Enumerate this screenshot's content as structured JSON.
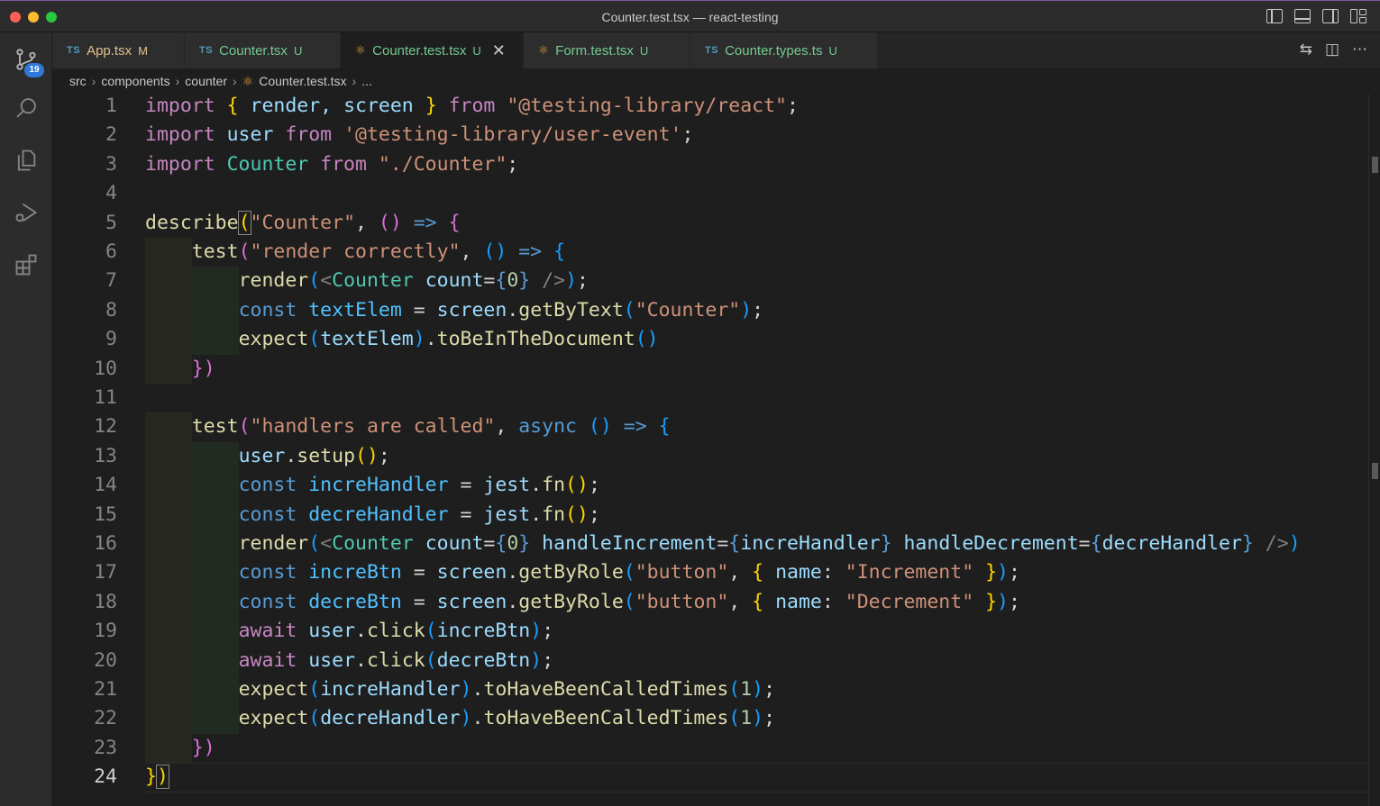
{
  "window": {
    "title": "Counter.test.tsx — react-testing"
  },
  "activity": {
    "scm_badge": "19"
  },
  "tabs": [
    {
      "icon": "TS",
      "name": "App.tsx",
      "status": "M"
    },
    {
      "icon": "⚛",
      "name": "Counter.tsx",
      "status": "U"
    },
    {
      "icon": "⚛",
      "name": "Counter.test.tsx",
      "status": "U",
      "close": "✕"
    },
    {
      "icon": "⚛",
      "name": "Form.test.tsx",
      "status": "U"
    },
    {
      "icon": "TS",
      "name": "Counter.types.ts",
      "status": "U"
    }
  ],
  "breadcrumb": {
    "parts": [
      "src",
      "components",
      "counter",
      "Counter.test.tsx",
      "..."
    ],
    "sep": "›"
  },
  "line_numbers": [
    "1",
    "2",
    "3",
    "4",
    "5",
    "6",
    "7",
    "8",
    "9",
    "10",
    "11",
    "12",
    "13",
    "14",
    "15",
    "16",
    "17",
    "18",
    "19",
    "20",
    "21",
    "22",
    "23",
    "24"
  ],
  "code": {
    "l1": [
      "import",
      " ",
      "{",
      " render, screen ",
      "}",
      " from ",
      "\"@testing-library/react\"",
      ";"
    ],
    "l2": [
      "import",
      " user ",
      "from",
      " ",
      "'@testing-library/user-event'",
      ";"
    ],
    "l3": [
      "import",
      " Counter ",
      "from",
      " ",
      "\"./Counter\"",
      ";"
    ],
    "l5": [
      "describe",
      "(",
      "\"Counter\"",
      ", ",
      "()",
      " => ",
      "{"
    ],
    "l6": [
      "test",
      "(",
      "\"render correctly\"",
      ", ",
      "()",
      " => ",
      "{"
    ],
    "l7": [
      "render",
      "(",
      "<",
      "Counter",
      " count",
      "=",
      "{",
      "0",
      "}",
      " />",
      ")",
      ";"
    ],
    "l8": [
      "const",
      " textElem ",
      "=",
      " screen",
      ".",
      "getByText",
      "(",
      "\"Counter\"",
      ")",
      ";"
    ],
    "l9": [
      "expect",
      "(",
      "textElem",
      ")",
      ".",
      "toBeInTheDocument",
      "()"
    ],
    "l10": [
      "}",
      ")"
    ],
    "l12": [
      "test",
      "(",
      "\"handlers are called\"",
      ", ",
      "async",
      " ",
      "()",
      " => ",
      "{"
    ],
    "l13": [
      "user",
      ".",
      "setup",
      "()",
      ";"
    ],
    "l14": [
      "const",
      " increHandler ",
      "=",
      " jest",
      ".",
      "fn",
      "()",
      ";"
    ],
    "l15": [
      "const",
      " decreHandler ",
      "=",
      " jest",
      ".",
      "fn",
      "()",
      ";"
    ],
    "l16": [
      "render",
      "(",
      "<",
      "Counter",
      " count",
      "=",
      "{",
      "0",
      "}",
      " handleIncrement",
      "=",
      "{",
      "increHandler",
      "}",
      " handleDecrement",
      "=",
      "{",
      "decreHandler",
      "}",
      " />",
      ")"
    ],
    "l17": [
      "const",
      " increBtn ",
      "=",
      " screen",
      ".",
      "getByRole",
      "(",
      "\"button\"",
      ", ",
      "{",
      " name",
      ": ",
      "\"Increment\"",
      " ",
      "}",
      ")",
      ";"
    ],
    "l18": [
      "const",
      " decreBtn ",
      "=",
      " screen",
      ".",
      "getByRole",
      "(",
      "\"button\"",
      ", ",
      "{",
      " name",
      ": ",
      "\"Decrement\"",
      " ",
      "}",
      ")",
      ";"
    ],
    "l19": [
      "await",
      " user",
      ".",
      "click",
      "(",
      "increBtn",
      ")",
      ";"
    ],
    "l20": [
      "await",
      " user",
      ".",
      "click",
      "(",
      "decreBtn",
      ")",
      ";"
    ],
    "l21": [
      "expect",
      "(",
      "increHandler",
      ")",
      ".",
      "toHaveBeenCalledTimes",
      "(",
      "1",
      ")",
      ";"
    ],
    "l22": [
      "expect",
      "(",
      "decreHandler",
      ")",
      ".",
      "toHaveBeenCalledTimes",
      "(",
      "1",
      ")",
      ";"
    ],
    "l23": [
      "}",
      ")"
    ],
    "l24": [
      "}",
      ")"
    ]
  },
  "colors": {
    "keyword": "#c586c0",
    "string": "#ce9178",
    "function": "#dcdcaa",
    "variable": "#9cdcfe",
    "constant": "#4fc1ff",
    "type": "#4ec9b0",
    "storage": "#569cd6",
    "number": "#b5cea8",
    "bracket1": "#ffd700",
    "bracket2": "#da70d6",
    "bracket3": "#179fff",
    "untracked": "#73c991",
    "modified": "#e2c08d"
  },
  "icons": [
    "source-control-icon",
    "search-icon",
    "explorer-icon",
    "run-debug-icon",
    "extensions-icon",
    "compare-changes-icon",
    "split-editor-icon",
    "more-actions-icon"
  ]
}
